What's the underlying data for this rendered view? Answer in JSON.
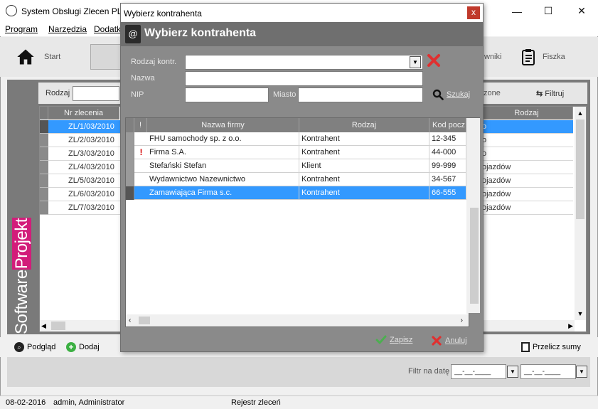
{
  "main": {
    "title": "System Obslugi Zlecen PL",
    "menu": [
      "Program",
      "Narzędzia",
      "Dodatk"
    ],
    "toolbar": {
      "start": "Start",
      "wniki": "wniki",
      "fiszka": "Fiszka"
    },
    "filter": {
      "rodzaj_label": "Rodzaj",
      "zone": "zone",
      "filtruj": "Filtruj"
    },
    "grid": {
      "col_nr": "Nr zlecenia",
      "col_rodzaj": "Rodzaj",
      "orders": [
        "ZL/1/03/2010",
        "ZL/2/03/2010",
        "ZL/3/03/2010",
        "ZL/4/03/2010",
        "ZL/5/03/2010",
        "ZL/6/03/2010",
        "ZL/7/03/2010"
      ],
      "rodzaj_partial": [
        "o",
        "o",
        "o",
        "ojazdów",
        "ojazdów",
        "ojazdów",
        "ojazdów"
      ]
    },
    "bottom": {
      "podglad": "Podgląd",
      "dodaj": "Dodaj",
      "przelicz": "Przelicz sumy"
    },
    "filter_date": {
      "label": "Filtr na datę",
      "from": "__-__-____",
      "to": "__-__-____"
    },
    "brand": {
      "part1": "Software",
      "part2": "Projekt"
    },
    "status": {
      "date": "08-02-2016",
      "user": "admin, Administrator",
      "module": "Rejestr zleceń"
    }
  },
  "dialog": {
    "window_title": "Wybierz kontrahenta",
    "header_title": "Wybierz kontrahenta",
    "close": "x",
    "form": {
      "rodzaj_label": "Rodzaj kontr.",
      "nazwa_label": "Nazwa",
      "nip_label": "NIP",
      "miasto_label": "Miasto",
      "rodzaj_value": "",
      "nazwa_value": "",
      "nip_value": "",
      "miasto_value": "",
      "szukaj": "Szukaj"
    },
    "grid": {
      "headers": {
        "flag": "!",
        "nazwa": "Nazwa firmy",
        "rodzaj": "Rodzaj",
        "kod": "Kod pocz"
      },
      "rows": [
        {
          "flag": "",
          "nazwa": "FHU samochody sp. z o.o.",
          "rodzaj": "Kontrahent",
          "kod": "12-345"
        },
        {
          "flag": "!",
          "nazwa": "Firma S.A.",
          "rodzaj": "Kontrahent",
          "kod": "44-000"
        },
        {
          "flag": "",
          "nazwa": "Stefański Stefan",
          "rodzaj": "Klient",
          "kod": "99-999"
        },
        {
          "flag": "",
          "nazwa": "Wydawnictwo Nazewnictwo",
          "rodzaj": "Kontrahent",
          "kod": "34-567"
        },
        {
          "flag": "",
          "nazwa": "Zamawiająca Firma s.c.",
          "rodzaj": "Kontrahent",
          "kod": "66-555"
        }
      ]
    },
    "footer": {
      "zapisz": "Zapisz",
      "anuluj": "Anuluj"
    }
  },
  "colors": {
    "selection": "#3399ff",
    "panel_gray": "#8a8a8a",
    "header_gray": "#6f6f6f",
    "danger_red": "#e03030",
    "ok_green": "#4caf50",
    "brand_pink": "#d21c7a"
  }
}
